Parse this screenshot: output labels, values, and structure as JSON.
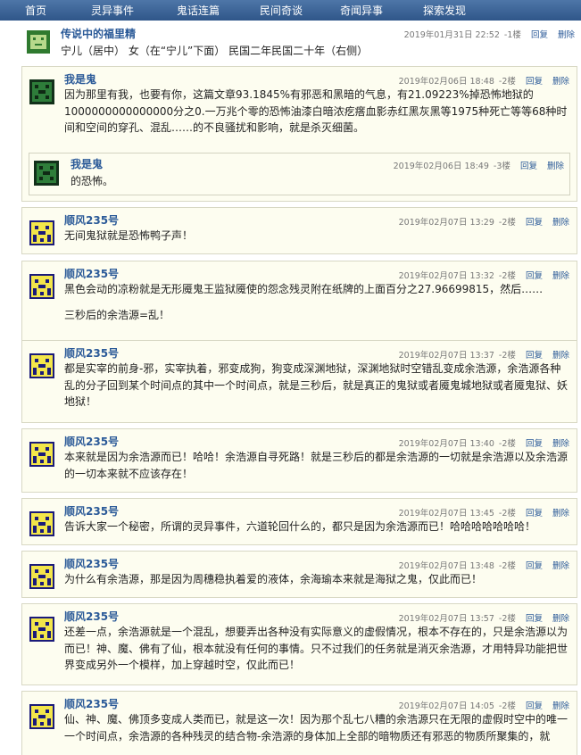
{
  "nav": [
    {
      "label": "首页"
    },
    {
      "label": "灵异事件"
    },
    {
      "label": "鬼话连篇"
    },
    {
      "label": "民间奇谈"
    },
    {
      "label": "奇闻异事"
    },
    {
      "label": "探索发现"
    }
  ],
  "root_post": {
    "author": "传说中的福里精",
    "time": "2019年01月31日  22:52",
    "floor": "-1楼",
    "reply_label": "回复",
    "delete_label": "删除",
    "content": "宁儿（居中）  女（在“宁儿”下面）  民国二年民国二十年（右侧）"
  },
  "replies": [
    {
      "author": "我是鬼",
      "time": "2019年02月06日  18:48",
      "floor": "-2楼",
      "reply_label": "回复",
      "delete_label": "删除",
      "paragraphs": [
        "因为那里有我，也要有你，这篇文章93.1845%有邪恶和黑暗的气息，有21.09223%掉恐怖地狱的1000000000000000分之0.一万兆个零的恐怖油漆白暗浓疙瘩血影赤红黑灰黑等1975种死亡等等68种时间和空间的穿孔、混乱……的不良骚扰和影响，就是杀灭细菌。"
      ],
      "sub": {
        "author": "我是鬼",
        "time": "2019年02月06日  18:49",
        "floor": "-3楼",
        "reply_label": "回复",
        "delete_label": "删除",
        "content": "的恐怖。"
      }
    },
    {
      "author": "顺风235号",
      "time": "2019年02月07日  13:29",
      "floor": "-2楼",
      "reply_label": "回复",
      "delete_label": "删除",
      "paragraphs": [
        "无间鬼狱就是恐怖鸭子声！"
      ]
    },
    {
      "author": "顺风235号",
      "time": "2019年02月07日  13:32",
      "floor": "-2楼",
      "reply_label": "回复",
      "delete_label": "删除",
      "paragraphs": [
        "黑色会动的凉粉就是无形魇鬼王监狱魇使的怨念残灵附在纸牌的上面百分之27.96699815，然后……",
        "三秒后的余浩源=乱！"
      ]
    },
    {
      "author": "顺风235号",
      "time": "2019年02月07日  13:37",
      "floor": "-2楼",
      "reply_label": "回复",
      "delete_label": "删除",
      "paragraphs": [
        "都是实宰的前身-邪，实宰执着，邪变成狗，狗变成深渊地狱，深渊地狱时空错乱变成余浩源，余浩源各种乱的分子回到某个时间点的其中一个时间点，就是三秒后，就是真正的鬼狱或者魇鬼城地狱或者魇鬼狱、妖地狱！"
      ]
    },
    {
      "author": "顺风235号",
      "time": "2019年02月07日  13:40",
      "floor": "-2楼",
      "reply_label": "回复",
      "delete_label": "删除",
      "paragraphs": [
        "本来就是因为余浩源而已！哈哈！余浩源自寻死路！就是三秒后的都是余浩源的一切就是余浩源以及余浩源的一切本来就不应该存在！"
      ]
    },
    {
      "author": "顺风235号",
      "time": "2019年02月07日  13:45",
      "floor": "-2楼",
      "reply_label": "回复",
      "delete_label": "删除",
      "paragraphs": [
        "告诉大家一个秘密，所谓的灵异事件，六道轮回什么的，都只是因为余浩源而已！哈哈哈哈哈哈哈！"
      ]
    },
    {
      "author": "顺风235号",
      "time": "2019年02月07日  13:48",
      "floor": "-2楼",
      "reply_label": "回复",
      "delete_label": "删除",
      "paragraphs": [
        "为什么有余浩源，那是因为周穗稳执着爱的液体，余海瑜本来就是海狱之鬼，仅此而已！"
      ]
    },
    {
      "author": "顺风235号",
      "time": "2019年02月07日  13:57",
      "floor": "-2楼",
      "reply_label": "回复",
      "delete_label": "删除",
      "paragraphs": [
        "还差一点，余浩源就是一个混乱，想要弄出各种没有实际意义的虚假情况，根本不存在的，只是余浩源以为而已！神、魔、佛有了仙，根本就没有任何的事情。只不过我们的任务就是消灭余浩源，才用特异功能把世界变成另外一个模样，加上穿越时空，仅此而已！"
      ]
    },
    {
      "author": "顺风235号",
      "time": "2019年02月07日  14:05",
      "floor": "-2楼",
      "reply_label": "回复",
      "delete_label": "删除",
      "paragraphs": [
        "仙、神、魔、佛顶多变成人类而已，就是这一次！因为那个乱七八糟的余浩源只在无限的虚假时空中的唯一一个时间点，余浩源的各种残灵的结合物-余浩源的身体加上全部的暗物质还有邪恶的物质所聚集的，就"
      ]
    }
  ],
  "colors": {
    "nav_bg": "#3a6296",
    "link": "#2b5a98",
    "reply_bg": "#fdfdf0",
    "avatar_green": "#2f7a2f",
    "avatar_blue": "#1a1a7a"
  },
  "icons": {
    "avatar_root": "pixel-invader-green-icon",
    "avatar_ghost": "pixel-invader-green-icon",
    "avatar_shunfeng": "pixel-invader-blue-yellow-icon"
  }
}
